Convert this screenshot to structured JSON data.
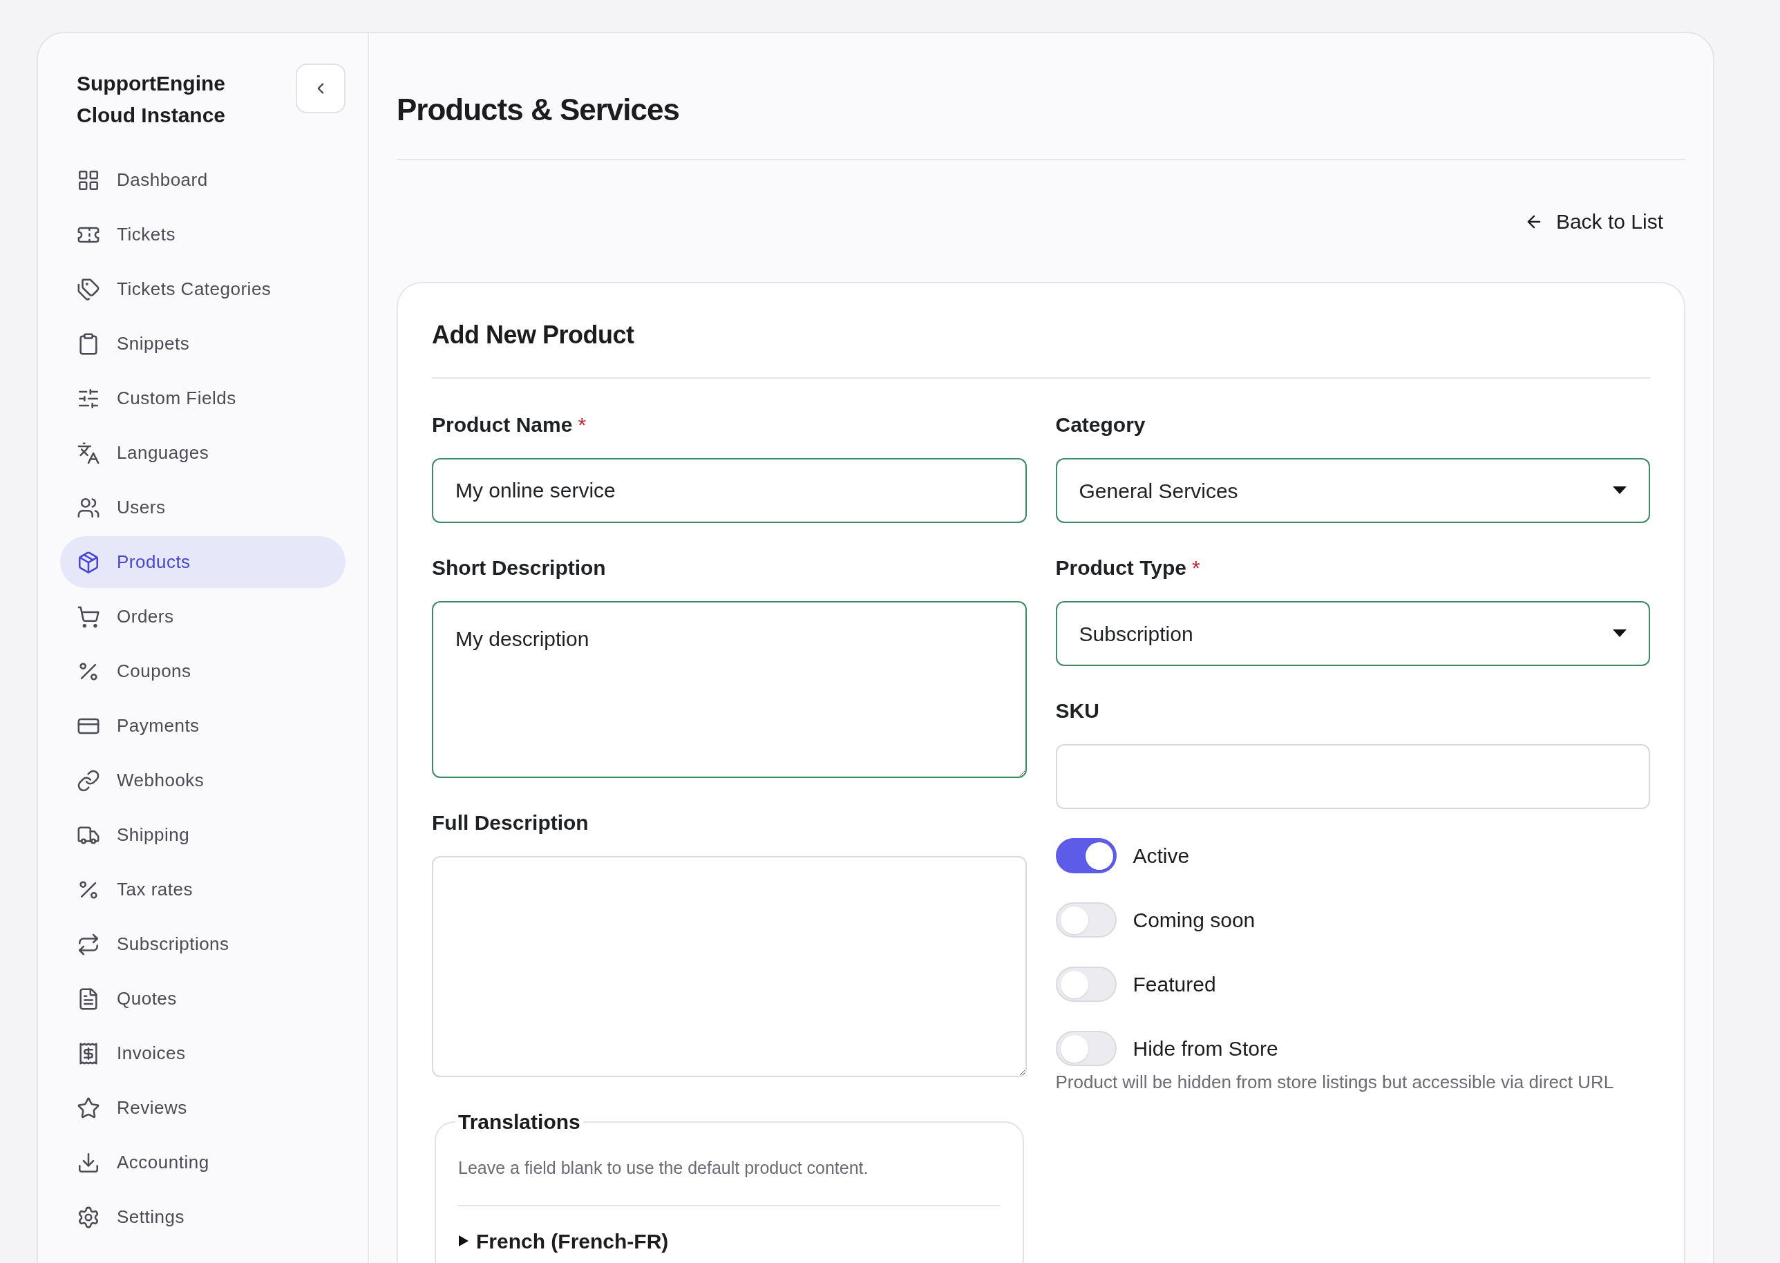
{
  "sidebar": {
    "title": [
      "SupportEngine",
      "Cloud Instance"
    ],
    "items": [
      {
        "label": "Dashboard",
        "selected": false
      },
      {
        "label": "Tickets",
        "selected": false
      },
      {
        "label": "Tickets Categories",
        "selected": false
      },
      {
        "label": "Snippets",
        "selected": false
      },
      {
        "label": "Custom Fields",
        "selected": false
      },
      {
        "label": "Languages",
        "selected": false
      },
      {
        "label": "Users",
        "selected": false
      },
      {
        "label": "Products",
        "selected": true
      },
      {
        "label": "Orders",
        "selected": false
      },
      {
        "label": "Coupons",
        "selected": false
      },
      {
        "label": "Payments",
        "selected": false
      },
      {
        "label": "Webhooks",
        "selected": false
      },
      {
        "label": "Shipping",
        "selected": false
      },
      {
        "label": "Tax rates",
        "selected": false
      },
      {
        "label": "Subscriptions",
        "selected": false
      },
      {
        "label": "Quotes",
        "selected": false
      },
      {
        "label": "Invoices",
        "selected": false
      },
      {
        "label": "Reviews",
        "selected": false
      },
      {
        "label": "Accounting",
        "selected": false
      },
      {
        "label": "Settings",
        "selected": false
      }
    ]
  },
  "page_title": "Products & Services",
  "back_link": "Back to List",
  "form": {
    "title": "Add New Product",
    "left": [
      {
        "kind": "input",
        "label": "Product Name",
        "required_mark": "*",
        "value": "My online service"
      },
      {
        "kind": "textarea",
        "label": "Short Description",
        "value": "My description"
      },
      {
        "kind": "textarea",
        "label": "Full Description"
      }
    ],
    "right": [
      {
        "kind": "select",
        "label": "Category",
        "value": "General Services"
      },
      {
        "kind": "select",
        "label": "Product Type",
        "required_mark": "*",
        "value": "Subscription"
      },
      {
        "kind": "input",
        "label": "SKU"
      }
    ],
    "toggles": [
      {
        "label": "Active",
        "on": true
      },
      {
        "label": "Coming soon",
        "on": false
      },
      {
        "label": "Featured",
        "on": false
      },
      {
        "label": "Hide from Store",
        "on": false
      }
    ],
    "toggle_hint": "Product will be hidden from store listings but accessible via direct URL",
    "translations": {
      "legend": "Translations",
      "hint": "Leave a field blank to use the default product content.",
      "languages": [
        {
          "label": "French (French-FR)",
          "expanded": false
        }
      ]
    }
  }
}
